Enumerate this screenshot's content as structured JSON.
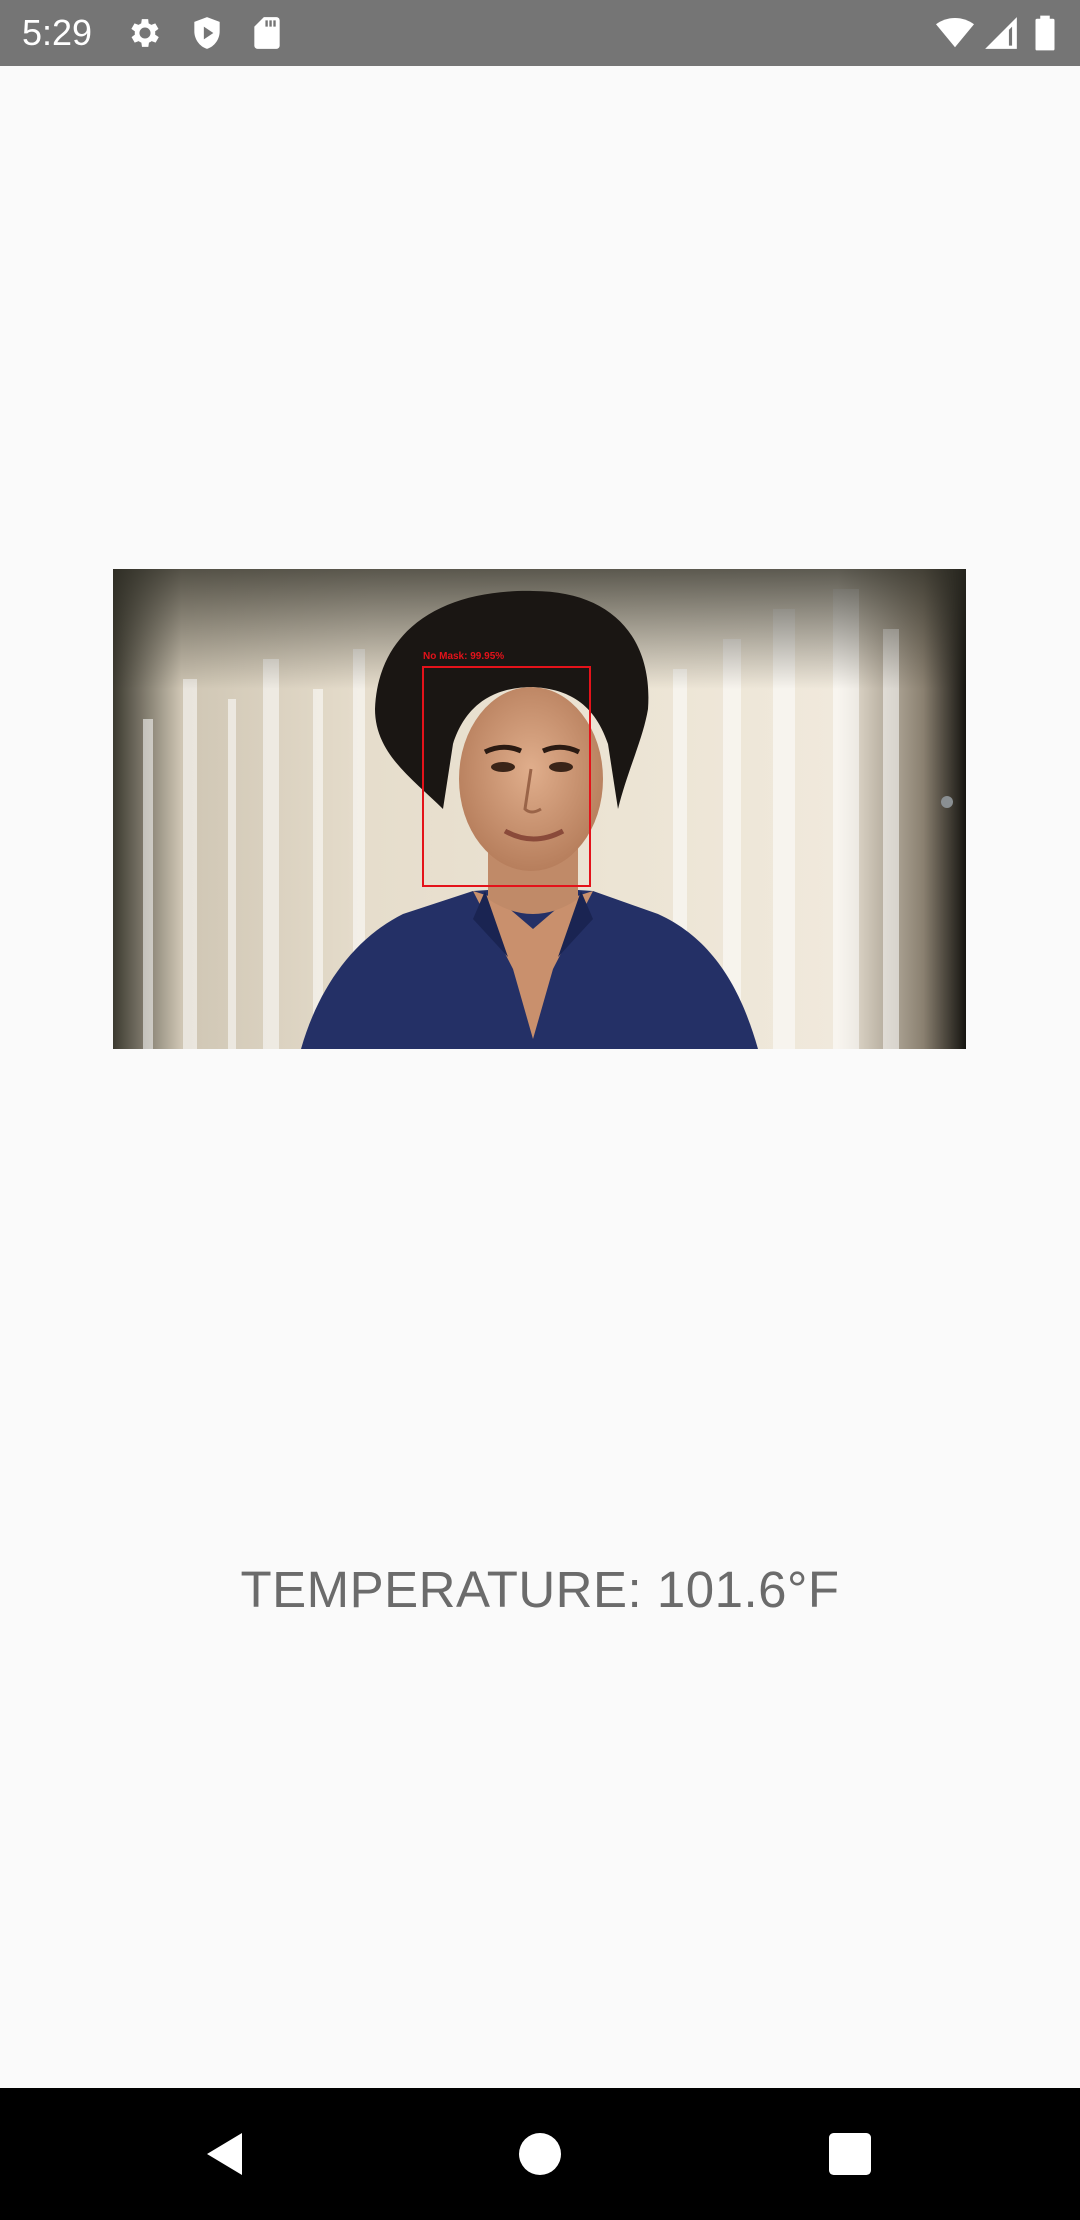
{
  "status_bar": {
    "time": "5:29",
    "left_icons": [
      "gear-icon",
      "shield-play-icon",
      "sd-card-icon"
    ],
    "right_icons": [
      "wifi-icon",
      "cellular-signal-icon",
      "battery-icon"
    ]
  },
  "detection": {
    "label": "No Mask: 99.95%",
    "box_color": "#e4121a"
  },
  "temperature": {
    "text": "TEMPERATURE: 101.6°F"
  },
  "nav_bar": {
    "buttons": [
      "back-icon",
      "home-icon",
      "recents-icon"
    ]
  },
  "colors": {
    "status_bar": "#757575",
    "background": "#fafafa",
    "text": "#6b6b6b",
    "nav_bar": "#000000"
  }
}
